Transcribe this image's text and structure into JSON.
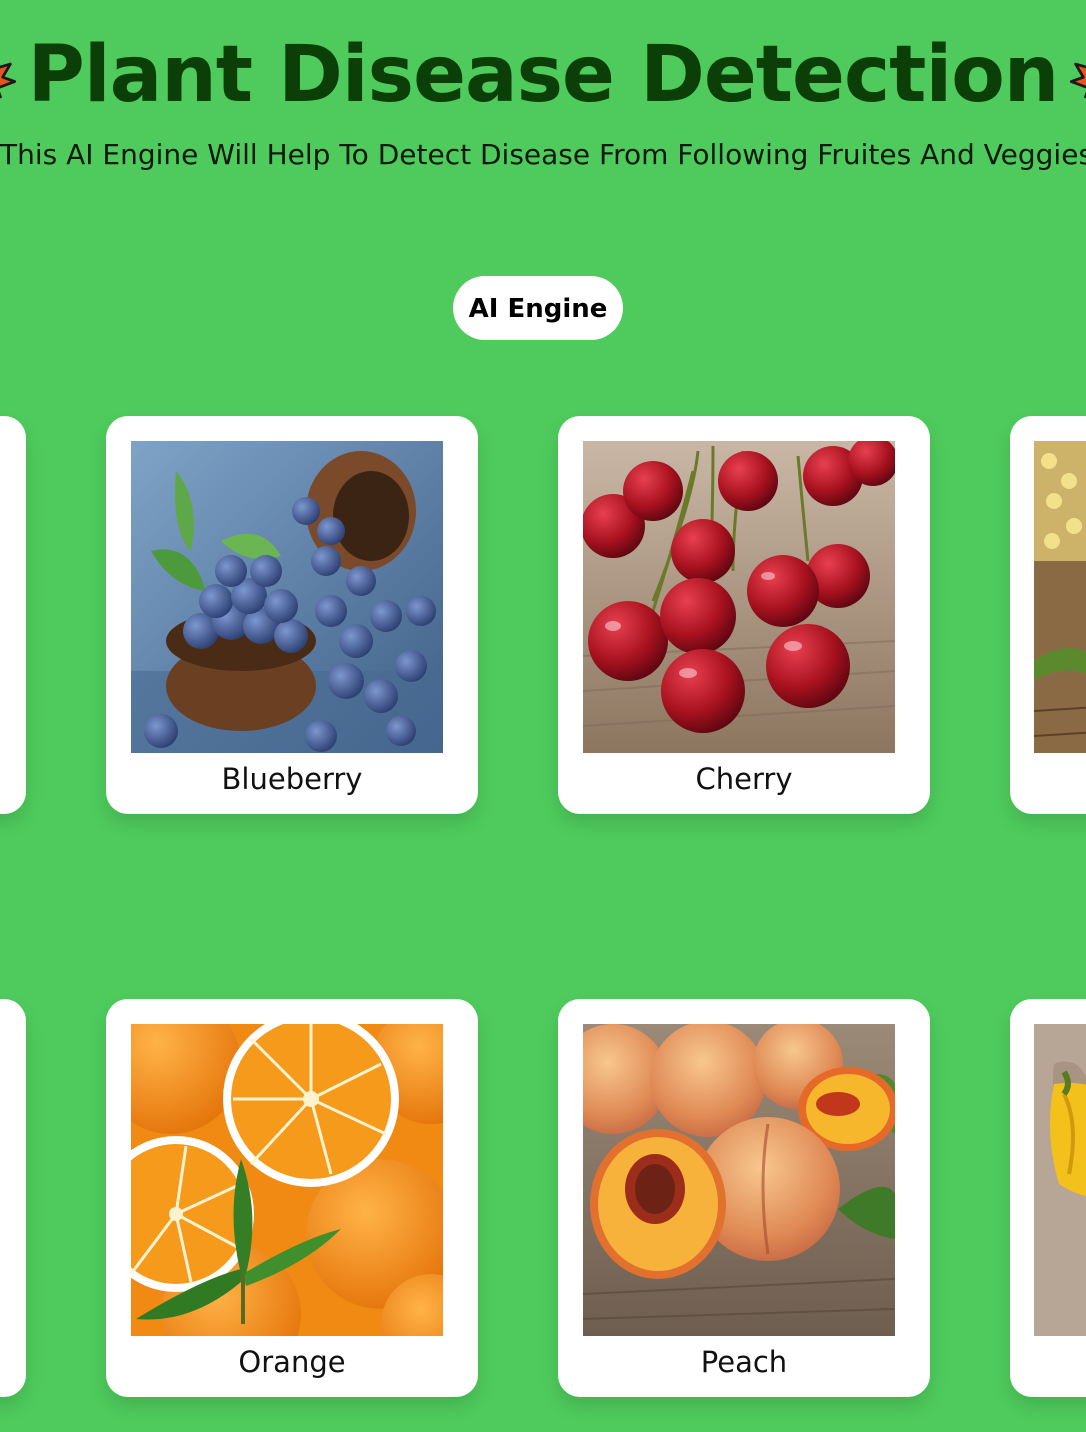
{
  "header": {
    "title": "Plant Disease Detection",
    "subtitle": "This AI Engine Will Help To Detect Disease From Following Fruites And Veggies",
    "title_icon": "maple-leaf-icon"
  },
  "action": {
    "engine_label": "AI Engine"
  },
  "cards": [
    {
      "name": "Blueberry",
      "image": "blueberry-image"
    },
    {
      "name": "Cherry",
      "image": "cherry-image"
    },
    {
      "name": "Orange",
      "image": "orange-image"
    },
    {
      "name": "Peach",
      "image": "peach-image"
    }
  ],
  "colors": {
    "background": "#4ecb5c",
    "title": "#0b3f07",
    "card": "#ffffff"
  }
}
